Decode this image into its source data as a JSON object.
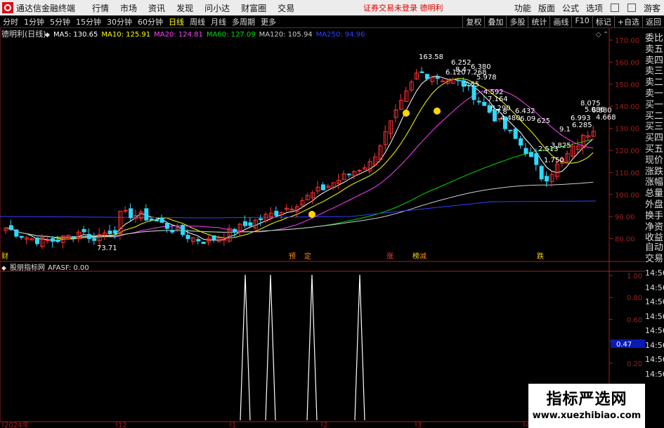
{
  "app": {
    "title": "通达信金融终端"
  },
  "menu": [
    "行情",
    "市场",
    "资讯",
    "发现",
    "问小达",
    "财富圈",
    "交易"
  ],
  "notice": "证券交易未登录  德明利",
  "menu_right": [
    "功能",
    "版面",
    "公式",
    "选项"
  ],
  "guest": "游客",
  "toolbar": {
    "timeframes": [
      "分时",
      "1分钟",
      "5分钟",
      "15分钟",
      "30分钟",
      "60分钟",
      "日线",
      "周线",
      "月线",
      "多周期",
      "更多"
    ],
    "active": "日线",
    "actions": [
      "复权",
      "叠加",
      "多股",
      "统计",
      "画线",
      "F10",
      "标记",
      "+自选",
      "返回"
    ]
  },
  "chart": {
    "stock_label": "德明利(日线)",
    "ma": [
      {
        "name": "MA5",
        "value": "130.65",
        "color": "#ffffff"
      },
      {
        "name": "MA10",
        "value": "125.91",
        "color": "#ffff00"
      },
      {
        "name": "MA20",
        "value": "124.81",
        "color": "#ff40ff"
      },
      {
        "name": "MA60",
        "value": "127.09",
        "color": "#00e000"
      },
      {
        "name": "MA120",
        "value": "105.94",
        "color": "#cccccc"
      },
      {
        "name": "MA250",
        "value": "94.96",
        "color": "#3040ff"
      }
    ],
    "price_ticks": [
      "170.00",
      "160.00",
      "150.00",
      "140.00",
      "130.00",
      "120.00",
      "110.00",
      "100.00",
      "90.00",
      "80.00"
    ],
    "high_label": "163.58",
    "low_label": "73.71",
    "annotations": [
      "6.252",
      "8.4",
      "6.380",
      "6.120",
      "7.268",
      "5.978",
      "7.55",
      "4.592",
      "7.164",
      "6.290",
      "7.8",
      "6.432",
      "4.480",
      "6.09",
      "625",
      "2.513",
      "3.825",
      "1.750",
      "6.993",
      "6.285",
      "9.1",
      "8.075",
      "5.086",
      "6.880",
      "4.668"
    ],
    "event_markers": [
      "预",
      "定",
      "涨",
      "榜",
      "减",
      "跌"
    ],
    "left_marker": "财"
  },
  "indicator": {
    "name": "股朋指标网",
    "formula": "AFASF: 0.00",
    "ticks": [
      "1.00",
      "0.80",
      "0.60",
      "0.40",
      "0.20"
    ],
    "current": "0.47"
  },
  "xaxis": [
    "2024年",
    "12",
    "1",
    "2",
    "3",
    "4"
  ],
  "right_panel": {
    "items": [
      "委比",
      "卖五",
      "卖四",
      "卖三",
      "卖二",
      "卖一",
      "买一",
      "买二",
      "买三",
      "买四",
      "买五",
      "现价",
      "涨跌",
      "涨幅",
      "总量",
      "外盘",
      "换手",
      "净资",
      "收益"
    ],
    "items2": [
      "自动",
      "交易"
    ],
    "times": [
      "14:56",
      "14:56",
      "14:56",
      "14:56",
      "14:56",
      "14:56",
      "14:56",
      "14:56"
    ]
  },
  "watermark": {
    "line1": "指标严选网",
    "line2": "www.xuezhibiao.com"
  }
}
